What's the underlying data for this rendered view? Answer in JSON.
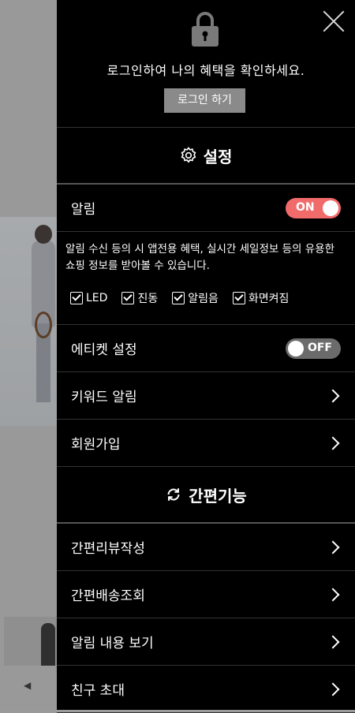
{
  "login": {
    "message": "로그인하여 나의 혜택을 확인하세요.",
    "button_label": "로그인 하기"
  },
  "settings_section": {
    "title": "설정",
    "icon": "gear-icon"
  },
  "notification": {
    "label": "알림",
    "toggle_state": "ON",
    "description": "알림 수신 등의 시 앱전용 혜택, 실시간 세일정보 등의 유용한 쇼핑 정보를 받아볼 수 있습니다.",
    "options": [
      "LED",
      "진동",
      "알림음",
      "화면켜짐"
    ]
  },
  "etiquette": {
    "label": "에티켓 설정",
    "toggle_state": "OFF"
  },
  "keyword_alert": {
    "label": "키워드 알림"
  },
  "signup": {
    "label": "회원가입"
  },
  "quick_section": {
    "title": "간편기능",
    "icon": "refresh-icon"
  },
  "quick_items": [
    "간편리뷰작성",
    "간편배송조회",
    "알림 내용 보기",
    "친구 초대"
  ],
  "colors": {
    "drawer_bg": "#000000",
    "toggle_on": "#f26b6b",
    "toggle_off": "#6b6b6b",
    "login_button": "#8a8a8a"
  },
  "background": {
    "arrow": "◀"
  }
}
